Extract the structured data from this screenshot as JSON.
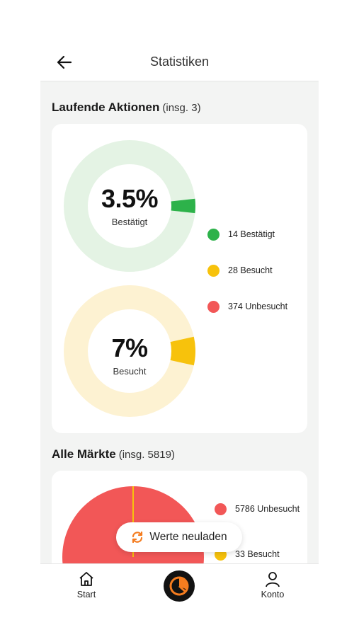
{
  "header": {
    "title": "Statistiken"
  },
  "sections": {
    "running": {
      "title": "Laufende Aktionen",
      "count": "(insg. 3)"
    },
    "markets": {
      "title": "Alle Märkte",
      "count": "(insg. 5819)"
    }
  },
  "donuts": [
    {
      "percent_label": "3.5%",
      "label": "Bestätigt",
      "fraction": 0.035,
      "color": "#2db24a",
      "track": "#e4f3e4"
    },
    {
      "percent_label": "7%",
      "label": "Besucht",
      "fraction": 0.07,
      "color": "#f7c20c",
      "track": "#fdf2d2"
    }
  ],
  "legend": [
    {
      "text": "14 Bestätigt",
      "color": "#2db24a"
    },
    {
      "text": "28 Besucht",
      "color": "#f7c20c"
    },
    {
      "text": "374 Unbesucht",
      "color": "#f25757"
    }
  ],
  "markets_legend": [
    {
      "text": "5786 Unbesucht",
      "color": "#f25757"
    },
    {
      "text": "33 Besucht",
      "color": "#f7c20c"
    }
  ],
  "chart_data": [
    {
      "type": "pie",
      "title": "",
      "categories": [
        "Bestätigt",
        "Besucht",
        "Unbesucht"
      ],
      "values": [
        14,
        28,
        374
      ]
    },
    {
      "type": "pie",
      "title": "",
      "categories": [
        "Unbesucht",
        "Besucht"
      ],
      "values": [
        5786,
        33
      ]
    }
  ],
  "reload": {
    "label": "Werte neuladen"
  },
  "nav": {
    "start": "Start",
    "konto": "Konto"
  },
  "colors": {
    "accent": "#f47c1f",
    "red": "#f25757",
    "green": "#2db24a",
    "yellow": "#f7c20c"
  }
}
